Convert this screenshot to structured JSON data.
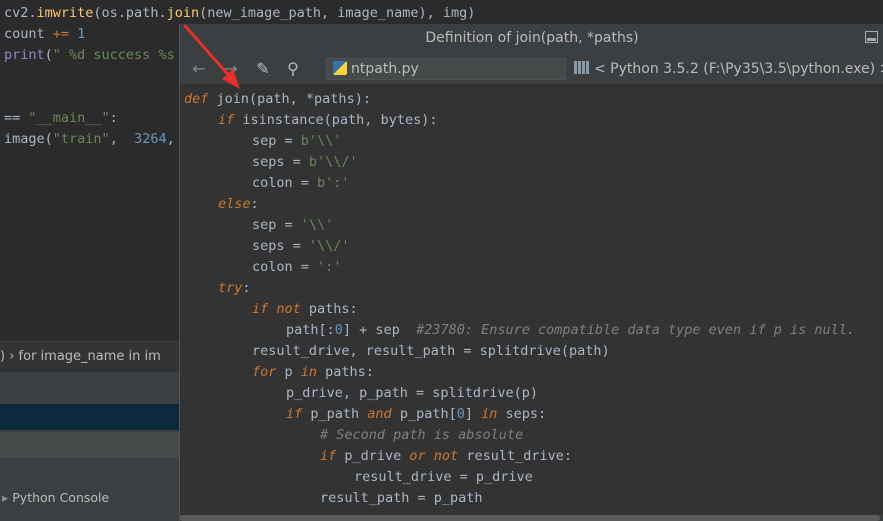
{
  "editor": {
    "lines": [
      [
        {
          "t": "cv2.",
          "c": "plain"
        },
        {
          "t": "imwrite",
          "c": "fn"
        },
        {
          "t": "(os.path.",
          "c": "plain"
        },
        {
          "t": "join",
          "c": "fn"
        },
        {
          "t": "(new_image_path, image_name), img)",
          "c": "plain"
        }
      ],
      [
        {
          "t": "count ",
          "c": "plain"
        },
        {
          "t": "+= ",
          "c": "kw"
        },
        {
          "t": "1",
          "c": "num"
        }
      ],
      [
        {
          "t": "print",
          "c": "builtin"
        },
        {
          "t": "(",
          "c": "plain"
        },
        {
          "t": "\" %d success %s",
          "c": "str"
        }
      ],
      [],
      [],
      [
        {
          "t": "== ",
          "c": "plain"
        },
        {
          "t": "\"__main__\"",
          "c": "str"
        },
        {
          "t": ":",
          "c": "plain"
        }
      ],
      [
        {
          "t": "image(",
          "c": "plain"
        },
        {
          "t": "\"train\"",
          "c": "str"
        },
        {
          "t": ",  ",
          "c": "plain"
        },
        {
          "t": "3264",
          "c": "num"
        },
        {
          "t": ",",
          "c": "plain"
        }
      ]
    ],
    "breadcrumb": ")  ›  for image_name in im",
    "console_tab": "Python Console"
  },
  "popup": {
    "title": "Definition of join(path, *paths)",
    "file_name": "ntpath.py",
    "interpreter": "< Python 3.5.2 (F:\\Py35\\3.5\\python.exe) >",
    "code": [
      {
        "i": 0,
        "s": [
          {
            "t": "def ",
            "c": "kw ital"
          },
          {
            "t": "join",
            "c": "plain"
          },
          {
            "t": "(path, *paths):",
            "c": "plain"
          }
        ]
      },
      {
        "i": 1,
        "s": [
          {
            "t": "if ",
            "c": "kw ital"
          },
          {
            "t": "isinstance",
            "c": "plain"
          },
          {
            "t": "(path, bytes):",
            "c": "plain"
          }
        ]
      },
      {
        "i": 2,
        "s": [
          {
            "t": "sep ",
            "c": "plain"
          },
          {
            "t": "= ",
            "c": "plain"
          },
          {
            "t": "b'\\\\'",
            "c": "str"
          }
        ]
      },
      {
        "i": 2,
        "s": [
          {
            "t": "seps ",
            "c": "plain"
          },
          {
            "t": "= ",
            "c": "plain"
          },
          {
            "t": "b'\\\\/'",
            "c": "str"
          }
        ]
      },
      {
        "i": 2,
        "s": [
          {
            "t": "colon ",
            "c": "plain"
          },
          {
            "t": "= ",
            "c": "plain"
          },
          {
            "t": "b':'",
            "c": "str"
          }
        ]
      },
      {
        "i": 1,
        "s": [
          {
            "t": "else",
            "c": "kw ital"
          },
          {
            "t": ":",
            "c": "plain"
          }
        ]
      },
      {
        "i": 2,
        "s": [
          {
            "t": "sep ",
            "c": "plain"
          },
          {
            "t": "= ",
            "c": "plain"
          },
          {
            "t": "'\\\\'",
            "c": "str"
          }
        ]
      },
      {
        "i": 2,
        "s": [
          {
            "t": "seps ",
            "c": "plain"
          },
          {
            "t": "= ",
            "c": "plain"
          },
          {
            "t": "'\\\\/'",
            "c": "str"
          }
        ]
      },
      {
        "i": 2,
        "s": [
          {
            "t": "colon ",
            "c": "plain"
          },
          {
            "t": "= ",
            "c": "plain"
          },
          {
            "t": "':'",
            "c": "str"
          }
        ]
      },
      {
        "i": 1,
        "s": [
          {
            "t": "try",
            "c": "kw ital"
          },
          {
            "t": ":",
            "c": "plain"
          }
        ]
      },
      {
        "i": 2,
        "s": [
          {
            "t": "if not ",
            "c": "kw ital"
          },
          {
            "t": "paths:",
            "c": "plain"
          }
        ]
      },
      {
        "i": 3,
        "s": [
          {
            "t": "path[:",
            "c": "plain"
          },
          {
            "t": "0",
            "c": "num"
          },
          {
            "t": "] + sep  ",
            "c": "plain"
          },
          {
            "t": "#23780: Ensure compatible data type even if p is null.",
            "c": "cmt"
          }
        ]
      },
      {
        "i": 2,
        "s": [
          {
            "t": "result_drive, result_path = splitdrive(path)",
            "c": "plain"
          }
        ]
      },
      {
        "i": 2,
        "s": [
          {
            "t": "for ",
            "c": "kw ital"
          },
          {
            "t": "p ",
            "c": "plain"
          },
          {
            "t": "in ",
            "c": "kw ital"
          },
          {
            "t": "paths:",
            "c": "plain"
          }
        ]
      },
      {
        "i": 3,
        "s": [
          {
            "t": "p_drive, p_path = splitdrive(p)",
            "c": "plain"
          }
        ]
      },
      {
        "i": 3,
        "s": [
          {
            "t": "if ",
            "c": "kw ital"
          },
          {
            "t": "p_path ",
            "c": "plain"
          },
          {
            "t": "and ",
            "c": "kw ital"
          },
          {
            "t": "p_path[",
            "c": "plain"
          },
          {
            "t": "0",
            "c": "num"
          },
          {
            "t": "] ",
            "c": "plain"
          },
          {
            "t": "in ",
            "c": "kw ital"
          },
          {
            "t": "seps:",
            "c": "plain"
          }
        ]
      },
      {
        "i": 4,
        "s": [
          {
            "t": "# Second path is absolute",
            "c": "cmt"
          }
        ]
      },
      {
        "i": 4,
        "s": [
          {
            "t": "if ",
            "c": "kw ital"
          },
          {
            "t": "p_drive ",
            "c": "plain"
          },
          {
            "t": "or not ",
            "c": "kw ital"
          },
          {
            "t": "result_drive:",
            "c": "plain"
          }
        ]
      },
      {
        "i": 5,
        "s": [
          {
            "t": "result_drive = p_drive",
            "c": "plain"
          }
        ]
      },
      {
        "i": 4,
        "s": [
          {
            "t": "result_path = p_path",
            "c": "plain"
          }
        ]
      }
    ]
  },
  "colors": {
    "annotation_arrow": "#e8302a"
  }
}
